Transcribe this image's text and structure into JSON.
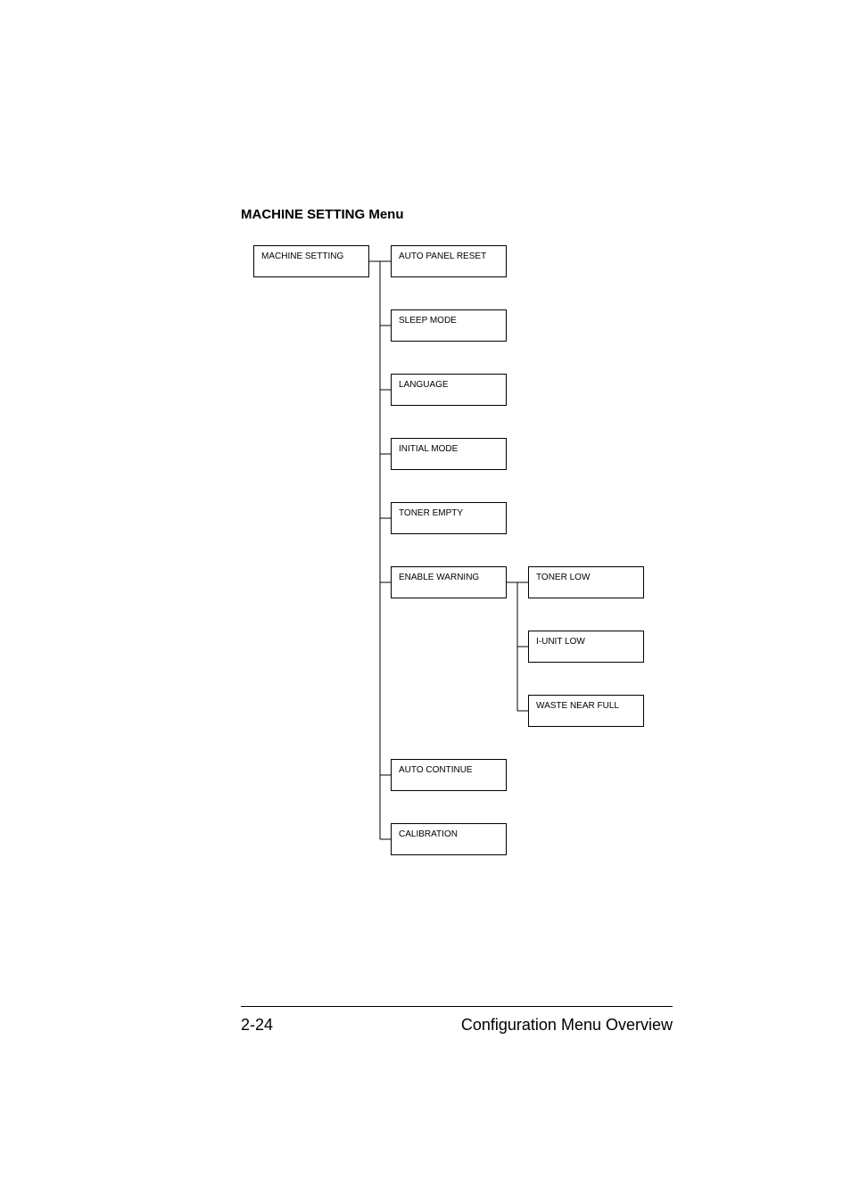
{
  "section_title": "MACHINE SETTING Menu",
  "tree": {
    "root": "MACHINE SETTING",
    "level2": [
      "AUTO PANEL RESET",
      "SLEEP MODE",
      "LANGUAGE",
      "INITIAL MODE",
      "TONER EMPTY",
      "ENABLE WARNING",
      "AUTO CONTINUE",
      "CALIBRATION"
    ],
    "level3_parent_index": 5,
    "level3": [
      "TONER LOW",
      "I-UNIT LOW",
      "WASTE NEAR FULL"
    ]
  },
  "footer": {
    "page": "2-24",
    "title": "Configuration Menu Overview"
  }
}
